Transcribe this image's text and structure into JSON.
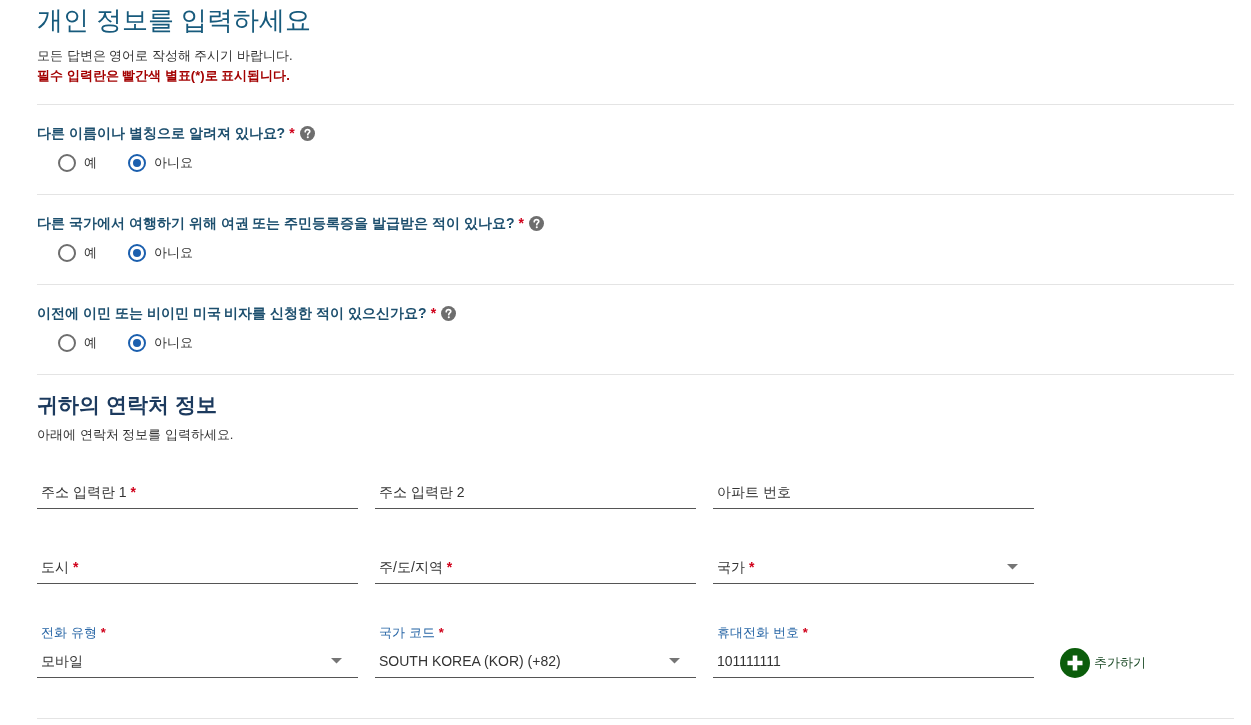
{
  "header": {
    "title": "개인 정보를 입력하세요",
    "note": "모든 답변은 영어로 작성해 주시기 바랍니다.",
    "required_note": "필수 입력란은 빨간색 별표(*)로 표시됩니다."
  },
  "questions": [
    {
      "text": "다른 이름이나 별칭으로 알려져 있나요?",
      "required_mark": "*",
      "help": true,
      "options": [
        {
          "label": "예",
          "selected": false
        },
        {
          "label": "아니요",
          "selected": true
        }
      ]
    },
    {
      "text": "다른 국가에서 여행하기 위해 여권 또는 주민등록증을 발급받은 적이 있나요?",
      "required_mark": "*",
      "help": true,
      "options": [
        {
          "label": "예",
          "selected": false
        },
        {
          "label": "아니요",
          "selected": true
        }
      ]
    },
    {
      "text": "이전에 이민 또는 비이민 미국 비자를 신청한 적이 있으신가요?",
      "required_mark": "*",
      "help": true,
      "options": [
        {
          "label": "예",
          "selected": false
        },
        {
          "label": "아니요",
          "selected": true
        }
      ]
    }
  ],
  "contact": {
    "title": "귀하의 연락처 정보",
    "subtitle": "아래에 연락처 정보를 입력하세요.",
    "rows": [
      {
        "fields": [
          {
            "kind": "text",
            "label": "주소 입력란 1",
            "required_mark": "*"
          },
          {
            "kind": "text",
            "label": "주소 입력란 2"
          },
          {
            "kind": "text",
            "label": "아파트 번호"
          }
        ]
      },
      {
        "fields": [
          {
            "kind": "text",
            "label": "도시",
            "required_mark": "*"
          },
          {
            "kind": "text",
            "label": "주/도/지역",
            "required_mark": "*"
          },
          {
            "kind": "select",
            "label": "국가",
            "required_mark": "*"
          }
        ]
      },
      {
        "fields": [
          {
            "kind": "select",
            "label": "전화 유형",
            "required_mark": "*",
            "value": "모바일"
          },
          {
            "kind": "select",
            "label": "국가 코드",
            "required_mark": "*",
            "value": "SOUTH KOREA (KOR) (+82)"
          },
          {
            "kind": "text",
            "label": "휴대전화 번호",
            "required_mark": "*",
            "value": "101111111"
          }
        ],
        "add_button": {
          "label": "추가하기"
        }
      }
    ]
  }
}
